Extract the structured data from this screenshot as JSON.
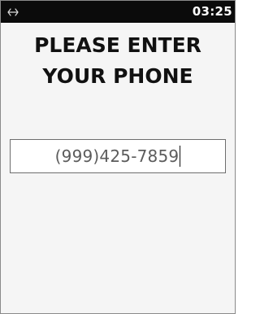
{
  "status_bar": {
    "icon": "arrows-left-right-icon",
    "time": "03:25"
  },
  "prompt": {
    "line1": "PLEASE ENTER",
    "line2": "YOUR PHONE"
  },
  "phone_field": {
    "value": "(999)425-7859"
  },
  "colors": {
    "status_bar_bg": "#0b0b0b",
    "screen_bg": "#f5f5f5",
    "field_border": "#6e6e6e",
    "prompt_text": "#111111",
    "field_text": "#5c5c5c"
  }
}
